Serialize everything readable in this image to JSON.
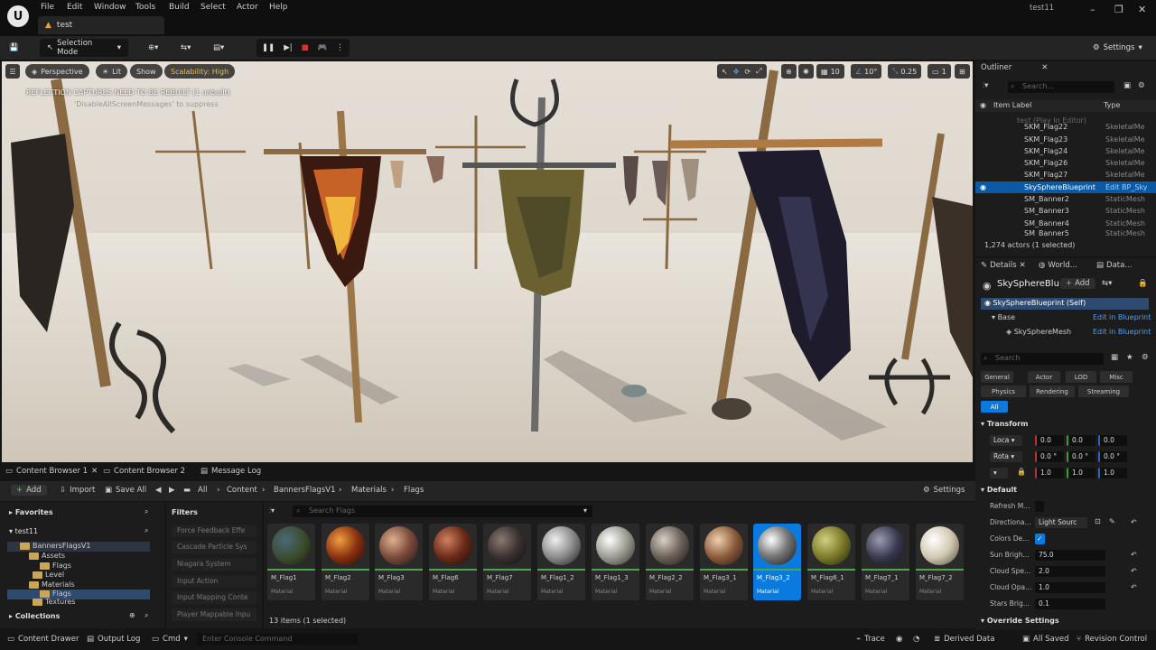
{
  "menu": {
    "items": [
      "File",
      "Edit",
      "Window",
      "Tools",
      "Build",
      "Select",
      "Actor",
      "Help"
    ],
    "project": "test11",
    "level_tab": "test"
  },
  "toolbar": {
    "mode": "Selection Mode",
    "settings": "Settings"
  },
  "viewport": {
    "perspective": "Perspective",
    "lit": "Lit",
    "show": "Show",
    "scalability": "Scalability: High",
    "warning": "REFLECTION CAPTURES NEED TO BE REBUILT (1 unbuilt)",
    "warning2": "'DisableAllScreenMessages' to suppress",
    "grid": "10",
    "angle": "10°",
    "scale": "0.25",
    "cam": "1"
  },
  "content_browser": {
    "tabs": [
      "Content Browser 1",
      "Content Browser 2",
      "Message Log"
    ],
    "add": "Add",
    "import": "Import",
    "save_all": "Save All",
    "breadcrumb": [
      "All",
      "Content",
      "BannersFlagsV1",
      "Materials",
      "Flags"
    ],
    "settings": "Settings",
    "favorites": "Favorites",
    "project_root": "test11",
    "tree": [
      "BannersFlagsV1",
      "Assets",
      "Flags",
      "Level",
      "Materials",
      "Flags",
      "Textures"
    ],
    "collections": "Collections",
    "filters_title": "Filters",
    "filters": [
      "Force Feedback Effe",
      "Cascade Particle Sys",
      "Niagara System",
      "Input Action",
      "Input Mapping Conte",
      "Player Mappable Inpu"
    ],
    "search_placeholder": "Search Flags",
    "items": [
      {
        "name": "M_Flag1",
        "type": "Material"
      },
      {
        "name": "M_Flag2",
        "type": "Material"
      },
      {
        "name": "M_Flag3",
        "type": "Material"
      },
      {
        "name": "M_Flag6",
        "type": "Material"
      },
      {
        "name": "M_Flag7",
        "type": "Material"
      },
      {
        "name": "M_Flag1_2",
        "type": "Material"
      },
      {
        "name": "M_Flag1_3",
        "type": "Material"
      },
      {
        "name": "M_Flag2_2",
        "type": "Material"
      },
      {
        "name": "M_Flag3_1",
        "type": "Material"
      },
      {
        "name": "M_Flag3_2",
        "type": "Material"
      },
      {
        "name": "M_Flag6_1",
        "type": "Material"
      },
      {
        "name": "M_Flag7_1",
        "type": "Material"
      },
      {
        "name": "M_Flag7_2",
        "type": "Material"
      }
    ],
    "count": "13 items (1 selected)"
  },
  "outliner": {
    "title": "Outliner",
    "search_placeholder": "Search...",
    "col_label": "Item Label",
    "col_type": "Type",
    "root": "test (Play In Editor)",
    "rows": [
      {
        "label": "SKM_Flag22",
        "type": "SkeletalMe"
      },
      {
        "label": "SKM_Flag23",
        "type": "SkeletalMe"
      },
      {
        "label": "SKM_Flag24",
        "type": "SkeletalMe"
      },
      {
        "label": "SKM_Flag26",
        "type": "SkeletalMe"
      },
      {
        "label": "SKM_Flag27",
        "type": "SkeletalMe"
      },
      {
        "label": "SkySphereBlueprint",
        "type": "Edit BP_Sky"
      },
      {
        "label": "SM_Banner2",
        "type": "StaticMesh"
      },
      {
        "label": "SM_Banner3",
        "type": "StaticMesh"
      },
      {
        "label": "SM_Banner4",
        "type": "StaticMesh"
      },
      {
        "label": "SM_Banner5",
        "type": "StaticMesh"
      }
    ],
    "count": "1,274 actors (1 selected)"
  },
  "details": {
    "tabs": [
      "Details",
      "World...",
      "Data..."
    ],
    "name": "SkySphereBlu",
    "add": "Add",
    "self": "SkySphereBlueprint (Self)",
    "base": "Base",
    "edit_bp": "Edit in Blueprint",
    "mesh": "SkySphereMesh",
    "search_placeholder": "Search",
    "cats": [
      "General",
      "Actor",
      "LOD",
      "Misc",
      "Physics",
      "Rendering",
      "Streaming",
      "All"
    ],
    "transform": "Transform",
    "loc": "Loca",
    "rot": "Rota",
    "scale_row": [
      "1.0",
      "1.0",
      "1.0"
    ],
    "loc_vals": [
      "0.0",
      "0.0",
      "0.0"
    ],
    "rot_vals": [
      "0.0 °",
      "0.0 °",
      "0.0 °"
    ],
    "default": "Default",
    "props": [
      {
        "k": "Refresh M...",
        "v": ""
      },
      {
        "k": "Directiona...",
        "v": "Light Sourc"
      },
      {
        "k": "Colors De...",
        "v": ""
      },
      {
        "k": "Sun Brigh...",
        "v": "75.0"
      },
      {
        "k": "Cloud Spe...",
        "v": "2.0"
      },
      {
        "k": "Cloud Opa...",
        "v": "1.0"
      },
      {
        "k": "Stars Brig...",
        "v": "0.1"
      }
    ],
    "override": "Override Settings"
  },
  "status": {
    "drawer": "Content Drawer",
    "output": "Output Log",
    "cmd": "Cmd",
    "console_placeholder": "Enter Console Command",
    "trace": "Trace",
    "derived": "Derived Data",
    "saved": "All Saved",
    "revision": "Revision Control"
  },
  "colors": {
    "accent": "#0a7adf",
    "selected": "#0a5aa8",
    "scalability": "#e6c04a"
  }
}
